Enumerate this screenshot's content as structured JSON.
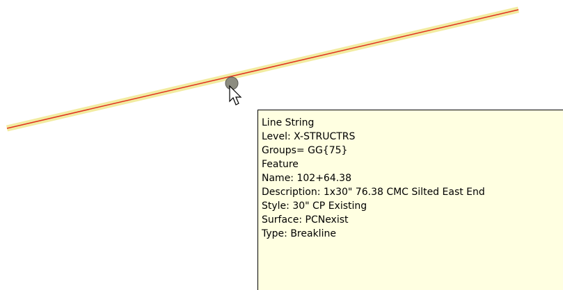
{
  "colors": {
    "background": "#ffffff",
    "line_highlight": "#f2eba0",
    "line_stroke": "#e0301e",
    "snap_point_fill": "#8c8c80",
    "tooltip_background": "#ffffe1",
    "tooltip_border": "#000000"
  },
  "cursor": {
    "icon": "arrow-pointer-icon"
  },
  "tooltip": {
    "lines": [
      "Line String",
      "Level: X-STRUCTRS",
      "Groups= GG{75}",
      "Feature",
      "Name: 102+64.38",
      "Description: 1x30\" 76.38 CMC Silted East End",
      "Style: 30\" CP Existing",
      "Surface: PCNexist",
      "Type: Breakline"
    ]
  }
}
